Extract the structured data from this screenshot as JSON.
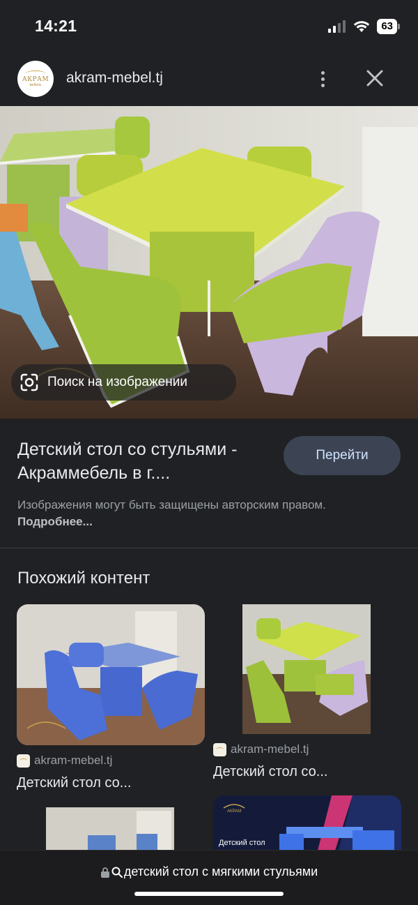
{
  "status_bar": {
    "time": "14:21",
    "battery": "63",
    "icons": [
      "signal-icon",
      "wifi-icon",
      "battery-icon"
    ]
  },
  "source": {
    "logo_text": "АКРАМ",
    "logo_sub": "мебель",
    "domain": "akram-mebel.tj",
    "icons": [
      "more-vert-icon",
      "close-icon"
    ]
  },
  "main_image": {
    "lens_label": "Поиск на изображении",
    "watermark": "АКРАМ мебель"
  },
  "result": {
    "title": "Детский стол со стульями - Акраммебель в г....",
    "visit_label": "Перейти",
    "copyright_text": "Изображения могут быть защищены авторским правом.",
    "copyright_link": "Подробнее..."
  },
  "related": {
    "heading": "Похожий контент",
    "cards": [
      {
        "source": "akram-mebel.tj",
        "title": "Детский стол со..."
      },
      {
        "source": "akram-mebel.tj",
        "title": "Детский стол со..."
      },
      {
        "source": "",
        "title": ""
      },
      {
        "source": "",
        "title": "",
        "overlay_text": "Детский стол"
      }
    ]
  },
  "bottom_bar": {
    "url_text": "детский стол с мягкими стульями",
    "icons": [
      "lock-icon",
      "search-icon"
    ]
  },
  "colors": {
    "background": "#202124",
    "lime": "#c6d93e",
    "lilac": "#c8b6e0",
    "blue": "#4a6fd6",
    "button": "#3c4453"
  }
}
